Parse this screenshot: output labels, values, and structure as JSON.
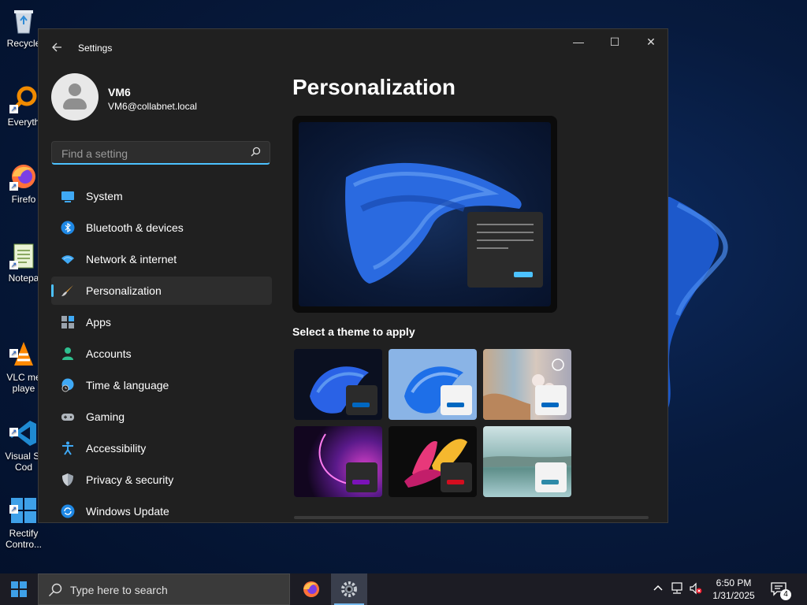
{
  "desktop": {
    "icons": [
      {
        "label": "Recycle",
        "icon": "recycle-bin-icon"
      },
      {
        "label": "Everyth",
        "icon": "everything-search-icon"
      },
      {
        "label": "Firefo",
        "icon": "firefox-icon"
      },
      {
        "label": "Notepa",
        "icon": "notepad-icon"
      },
      {
        "label": "VLC me\nplaye",
        "icon": "vlc-icon"
      },
      {
        "label": "Visual St\nCod",
        "icon": "vscode-icon"
      },
      {
        "label": "Rectify\nContro...",
        "icon": "control-panel-icon"
      }
    ]
  },
  "window": {
    "title": "Settings",
    "controls": {
      "minimize": "—",
      "maximize": "☐",
      "close": "✕"
    }
  },
  "profile": {
    "name": "VM6",
    "email": "VM6@collabnet.local"
  },
  "search": {
    "placeholder": "Find a setting"
  },
  "nav": {
    "items": [
      {
        "label": "System",
        "icon": "system-icon"
      },
      {
        "label": "Bluetooth & devices",
        "icon": "bluetooth-icon"
      },
      {
        "label": "Network & internet",
        "icon": "wifi-icon"
      },
      {
        "label": "Personalization",
        "icon": "brush-icon",
        "active": true
      },
      {
        "label": "Apps",
        "icon": "apps-icon"
      },
      {
        "label": "Accounts",
        "icon": "accounts-icon"
      },
      {
        "label": "Time & language",
        "icon": "clock-globe-icon"
      },
      {
        "label": "Gaming",
        "icon": "gamepad-icon"
      },
      {
        "label": "Accessibility",
        "icon": "accessibility-icon"
      },
      {
        "label": "Privacy & security",
        "icon": "shield-icon"
      },
      {
        "label": "Windows Update",
        "icon": "update-icon"
      }
    ]
  },
  "content": {
    "page_title": "Personalization",
    "section_label": "Select a theme to apply",
    "themes": [
      {
        "name": "windows-dark",
        "accent": "#0067c0"
      },
      {
        "name": "windows-light",
        "accent": "#0067c0"
      },
      {
        "name": "windows-spotlight",
        "accent": "#0067c0"
      },
      {
        "name": "glow",
        "accent": "#7a12b8"
      },
      {
        "name": "captured-motion",
        "accent": "#d40d1f"
      },
      {
        "name": "flow",
        "accent": "#2e8aa8"
      }
    ]
  },
  "taskbar": {
    "search_placeholder": "Type here to search",
    "apps": [
      "firefox-icon",
      "settings-icon"
    ],
    "time": "6:50 PM",
    "date": "1/31/2025",
    "notification_count": "4"
  },
  "colors": {
    "accent": "#4cc2ff",
    "window_bg": "#202020",
    "taskbar_bg": "#1c1c24"
  }
}
